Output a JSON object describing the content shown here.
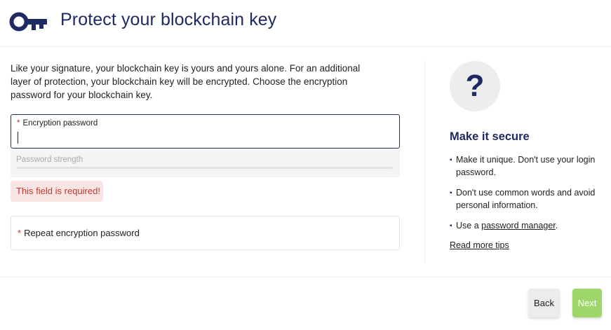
{
  "header": {
    "title": "Protect your blockchain key",
    "icon": "key-icon"
  },
  "intro": {
    "text": "Like your signature, your blockchain key is yours and yours alone. For an additional layer of protection, your blockchain key will be encrypted. Choose the encryption password for your blockchain key."
  },
  "form": {
    "required_mark": "*",
    "password_label": "Encryption password",
    "password_value": "",
    "strength_label": "Password strength",
    "strength_level": 0,
    "error_text": "This field is required!",
    "repeat_label": "Repeat encryption password",
    "repeat_value": ""
  },
  "help": {
    "icon": "question-mark-icon",
    "icon_glyph": "?",
    "title": "Make it secure",
    "bullet": "▪",
    "tip1": "Make it unique. Don't use your login password.",
    "tip2": "Don't use common words and avoid personal information.",
    "tip3_prefix": "Use a ",
    "tip3_link": "password manager",
    "tip3_suffix": ".",
    "read_more": "Read more tips"
  },
  "footer": {
    "back_label": "Back",
    "next_label": "Next"
  },
  "colors": {
    "brand_navy": "#1f2a63",
    "error_red": "#c0392b",
    "error_bg": "#fbe4e4",
    "next_green": "#9ed66a",
    "circle_grey": "#ededed"
  }
}
